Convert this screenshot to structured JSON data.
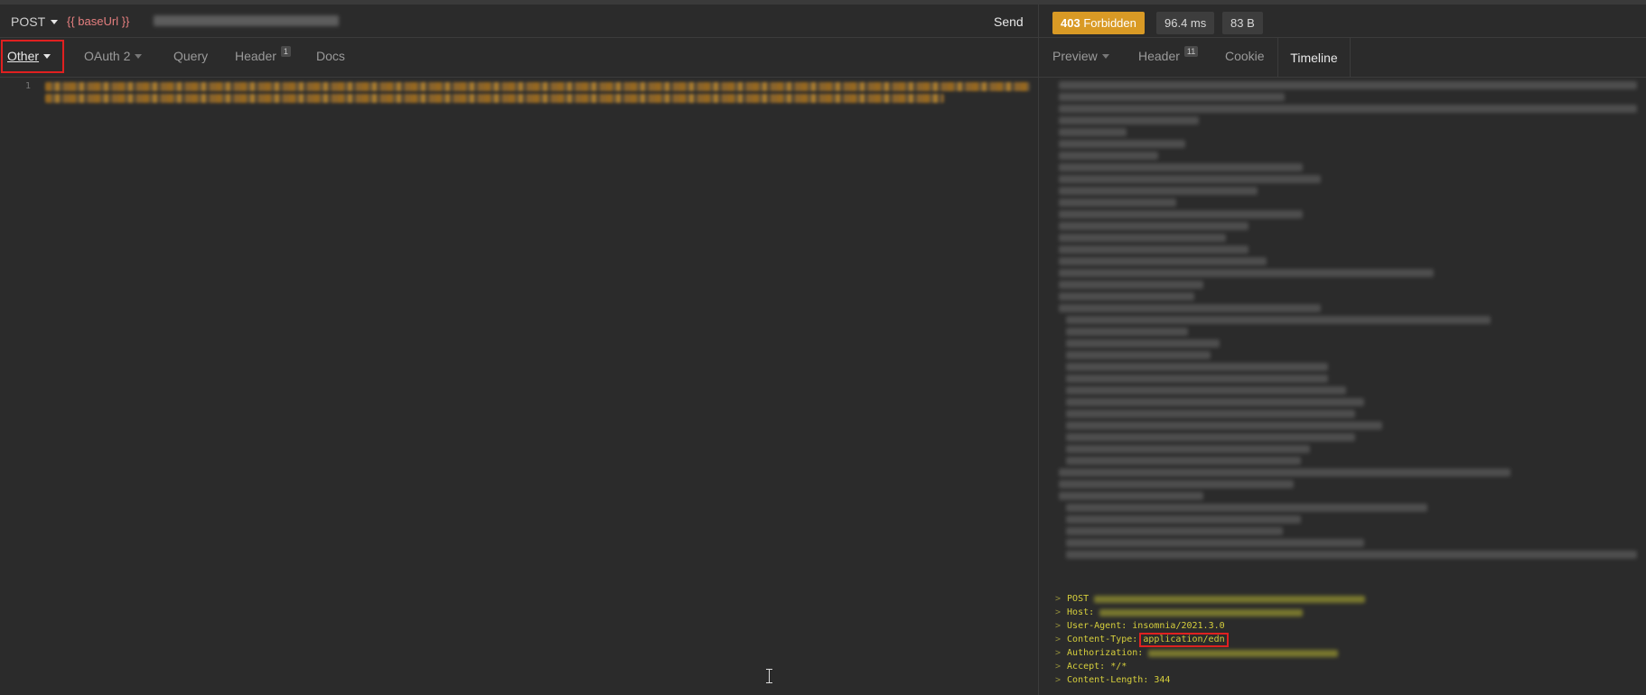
{
  "request": {
    "method": "POST",
    "url_prefix": "{{ baseUrl }}",
    "send_label": "Send",
    "tabs": [
      {
        "label": "Other"
      },
      {
        "label": "OAuth 2"
      },
      {
        "label": "Query"
      },
      {
        "label": "Header",
        "count": "1"
      },
      {
        "label": "Docs"
      }
    ],
    "line_number": "1"
  },
  "response": {
    "status": "403",
    "status_text": "Forbidden",
    "time": "96.4 ms",
    "size": "83 B",
    "tabs": [
      {
        "label": "Preview"
      },
      {
        "label": "Header",
        "count": "11"
      },
      {
        "label": "Cookie"
      },
      {
        "label": "Timeline"
      }
    ]
  },
  "timeline": {
    "prefix": ">",
    "request_lines": [
      {
        "key": "POST"
      },
      {
        "key": "Host:"
      },
      {
        "key": "User-Agent: insomnia/2021.3.0"
      },
      {
        "key": "Content-Type:",
        "value": "application/edn"
      },
      {
        "key": "Authorization:"
      },
      {
        "key": "Accept: */*"
      },
      {
        "key": "Content-Length: 344"
      }
    ]
  },
  "colors": {
    "status_badge": "#d99a25",
    "highlight_box": "#e02020",
    "url_variable": "#e57f7f",
    "timeline_text": "#d6cf3c"
  }
}
